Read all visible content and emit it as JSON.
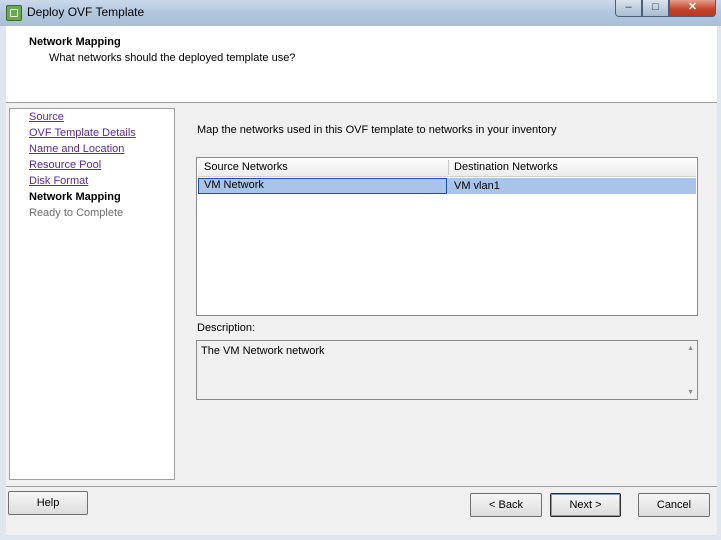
{
  "window": {
    "title": "Deploy OVF Template",
    "minimize_glyph": "–",
    "maximize_glyph": "□",
    "close_glyph": "✕"
  },
  "header": {
    "title": "Network Mapping",
    "subtitle": "What networks should the deployed template use?"
  },
  "steps": [
    {
      "label": "Source",
      "state": "link"
    },
    {
      "label": "OVF Template Details",
      "state": "link"
    },
    {
      "label": "Name and Location",
      "state": "link"
    },
    {
      "label": "Resource Pool",
      "state": "link"
    },
    {
      "label": "Disk Format",
      "state": "link"
    },
    {
      "label": "Network Mapping",
      "state": "current"
    },
    {
      "label": "Ready to Complete",
      "state": "disabled"
    }
  ],
  "main": {
    "instruction": "Map the networks used in this OVF template to networks in your inventory",
    "table": {
      "columns": [
        "Source Networks",
        "Destination Networks"
      ],
      "rows": [
        {
          "source": "VM Network",
          "destination": "VM vlan1",
          "selected": true
        }
      ]
    },
    "description_label": "Description:",
    "description_text": "The VM Network network"
  },
  "buttons": {
    "help": "Help",
    "back": "< Back",
    "next": "Next >",
    "cancel": "Cancel"
  },
  "colors": {
    "selection": "#a8c4e8",
    "link": "#5a2a9a",
    "close_button": "#c7452b"
  }
}
